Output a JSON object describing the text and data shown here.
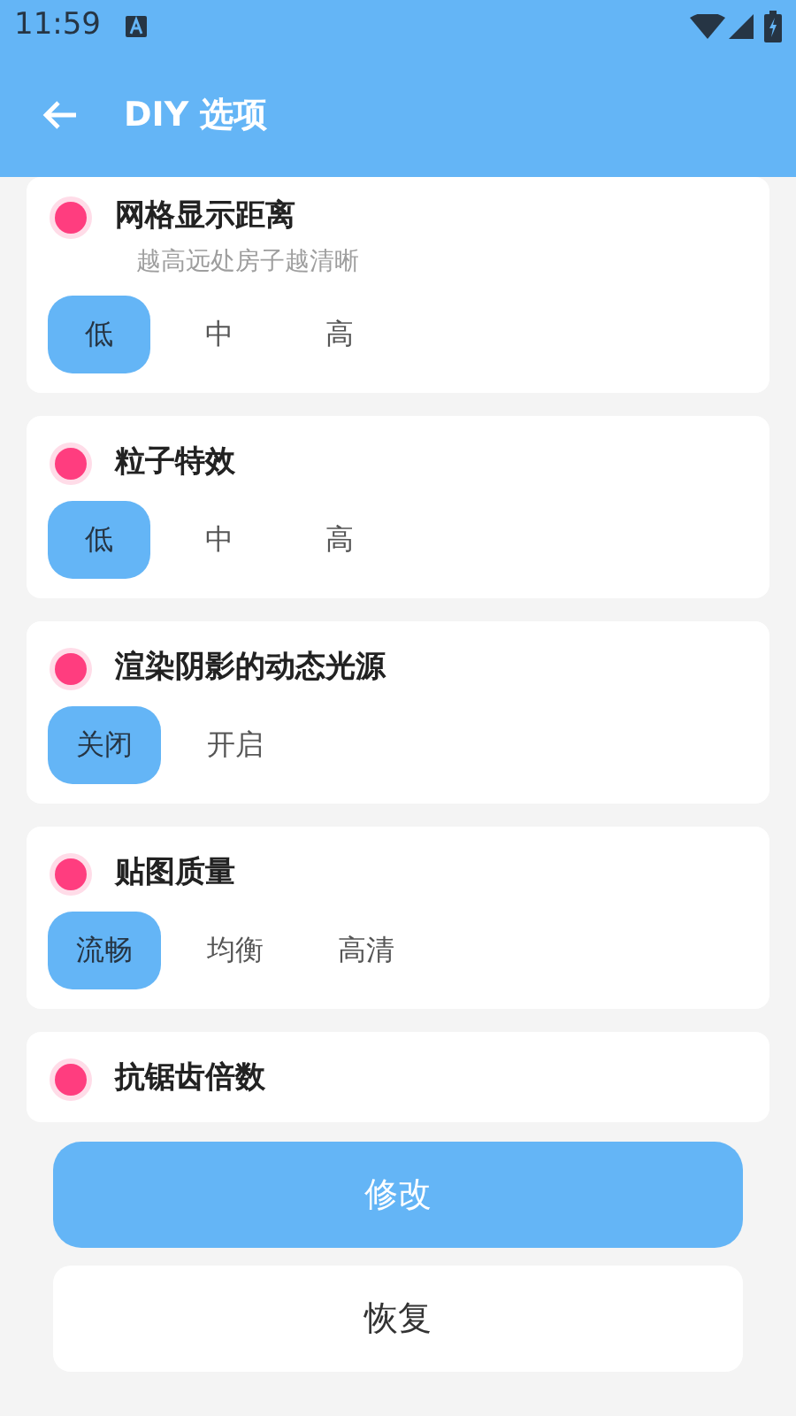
{
  "status_bar": {
    "time": "11:59"
  },
  "app_bar": {
    "title": "DIY 选项"
  },
  "settings": [
    {
      "title": "网格显示距离",
      "subtitle": "越高远处房子越清晰",
      "options": [
        {
          "label": "低",
          "selected": true
        },
        {
          "label": "中",
          "selected": false
        },
        {
          "label": "高",
          "selected": false
        }
      ]
    },
    {
      "title": "粒子特效",
      "options": [
        {
          "label": "低",
          "selected": true
        },
        {
          "label": "中",
          "selected": false
        },
        {
          "label": "高",
          "selected": false
        }
      ]
    },
    {
      "title": "渲染阴影的动态光源",
      "options": [
        {
          "label": "关闭",
          "selected": true
        },
        {
          "label": "开启",
          "selected": false
        }
      ]
    },
    {
      "title": "贴图质量",
      "options": [
        {
          "label": "流畅",
          "selected": true
        },
        {
          "label": "均衡",
          "selected": false
        },
        {
          "label": "高清",
          "selected": false
        }
      ]
    },
    {
      "title": "抗锯齿倍数"
    }
  ],
  "buttons": {
    "primary": "修改",
    "secondary": "恢复"
  }
}
